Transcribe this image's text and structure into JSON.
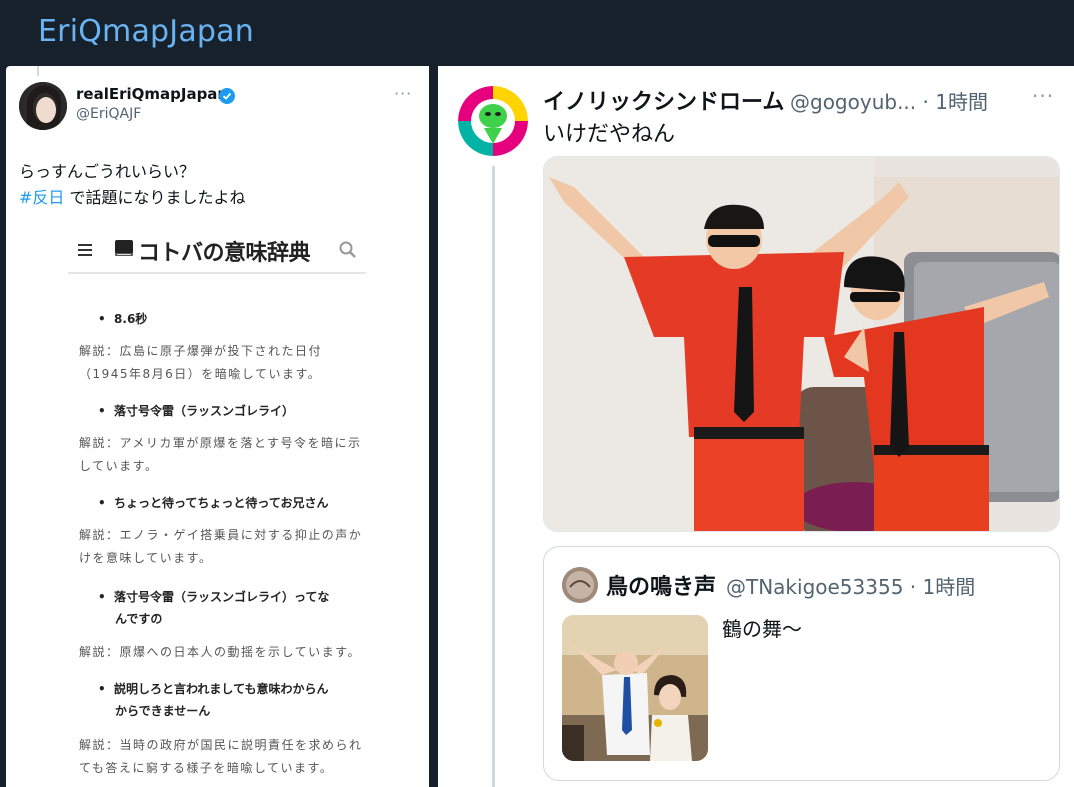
{
  "header": {
    "title": "EriQmapJapan"
  },
  "left_tweet": {
    "name": "realEriQmapJapan",
    "handle": "@EriQAJF",
    "more": "···",
    "line1": "らっすんごうれいらい？",
    "hashtag": "#反日",
    "line2_rest": " で話題になりましたよね",
    "dictionary": {
      "title": "コトバの意味辞典",
      "entries": [
        {
          "bullet": "8.6秒",
          "explain": [
            "解説：広島に原子爆弾が投下された日付",
            "（1945年8月6日）を暗喩しています。"
          ]
        },
        {
          "bullet": "落寸号令雷（ラッスンゴレライ）",
          "explain": [
            "解説：アメリカ軍が原爆を落とす号令を暗に示",
            "しています。"
          ]
        },
        {
          "bullet": "ちょっと待ってちょっと待ってお兄さん",
          "explain": [
            "解説：エノラ・ゲイ搭乗員に対する抑止の声か",
            "けを意味しています。"
          ]
        },
        {
          "bullet": "落寸号令雷（ラッスンゴレライ）ってな",
          "bullet2": "んですの",
          "explain": [
            "解説：原爆への日本人の動揺を示しています。"
          ]
        },
        {
          "bullet": "説明しろと言われましても意味わからん",
          "bullet2": "からできませーん",
          "explain": [
            "解説：当時の政府が国民に説明責任を求められ",
            "ても答えに窮する様子を暗喩しています。"
          ]
        }
      ]
    }
  },
  "right_tweet": {
    "name": "イノリックシンドローム",
    "handle": "@gogoyub... · 1時間",
    "more": "···",
    "text": "いけだやねん",
    "quote": {
      "name": "鳥の鳴き声",
      "handle": "@TNakigoe53355 · 1時間",
      "text": "鶴の舞〜"
    }
  },
  "colors": {
    "accent": "#6ab3f3",
    "link": "#1d9bf0",
    "bg_dark": "#17212b"
  }
}
